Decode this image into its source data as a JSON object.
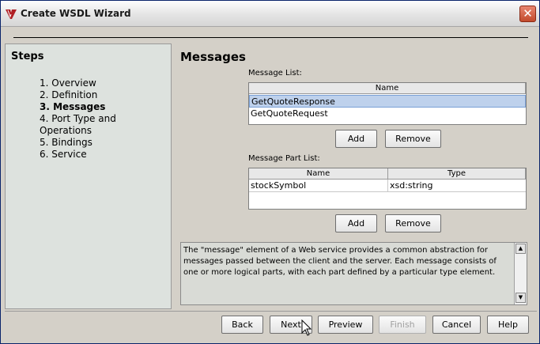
{
  "window": {
    "title": "Create WSDL Wizard"
  },
  "steps": {
    "title": "Steps",
    "items": [
      {
        "label": "1. Overview",
        "current": false
      },
      {
        "label": "2. Definition",
        "current": false
      },
      {
        "label": "3. Messages",
        "current": true
      },
      {
        "label": "4. Port Type and Operations",
        "current": false
      },
      {
        "label": "5. Bindings",
        "current": false
      },
      {
        "label": "6. Service",
        "current": false
      }
    ]
  },
  "messages": {
    "title": "Messages",
    "message_list": {
      "label": "Message List:",
      "column": "Name",
      "rows": [
        "GetQuoteResponse",
        "GetQuoteRequest"
      ],
      "selected": "GetQuoteResponse",
      "add_label": "Add",
      "remove_label": "Remove"
    },
    "part_list": {
      "label": "Message Part List:",
      "columns": [
        "Name",
        "Type"
      ],
      "rows": [
        {
          "name": "stockSymbol",
          "type": "xsd:string"
        }
      ],
      "add_label": "Add",
      "remove_label": "Remove"
    },
    "description": "The \"message\" element of a Web service provides a common abstraction for messages passed between the client and the server. Each message consists of one or more logical parts, with each part defined by a particular type element."
  },
  "footer": {
    "back": "Back",
    "next": "Next",
    "preview": "Preview",
    "finish": "Finish",
    "cancel": "Cancel",
    "help": "Help"
  }
}
